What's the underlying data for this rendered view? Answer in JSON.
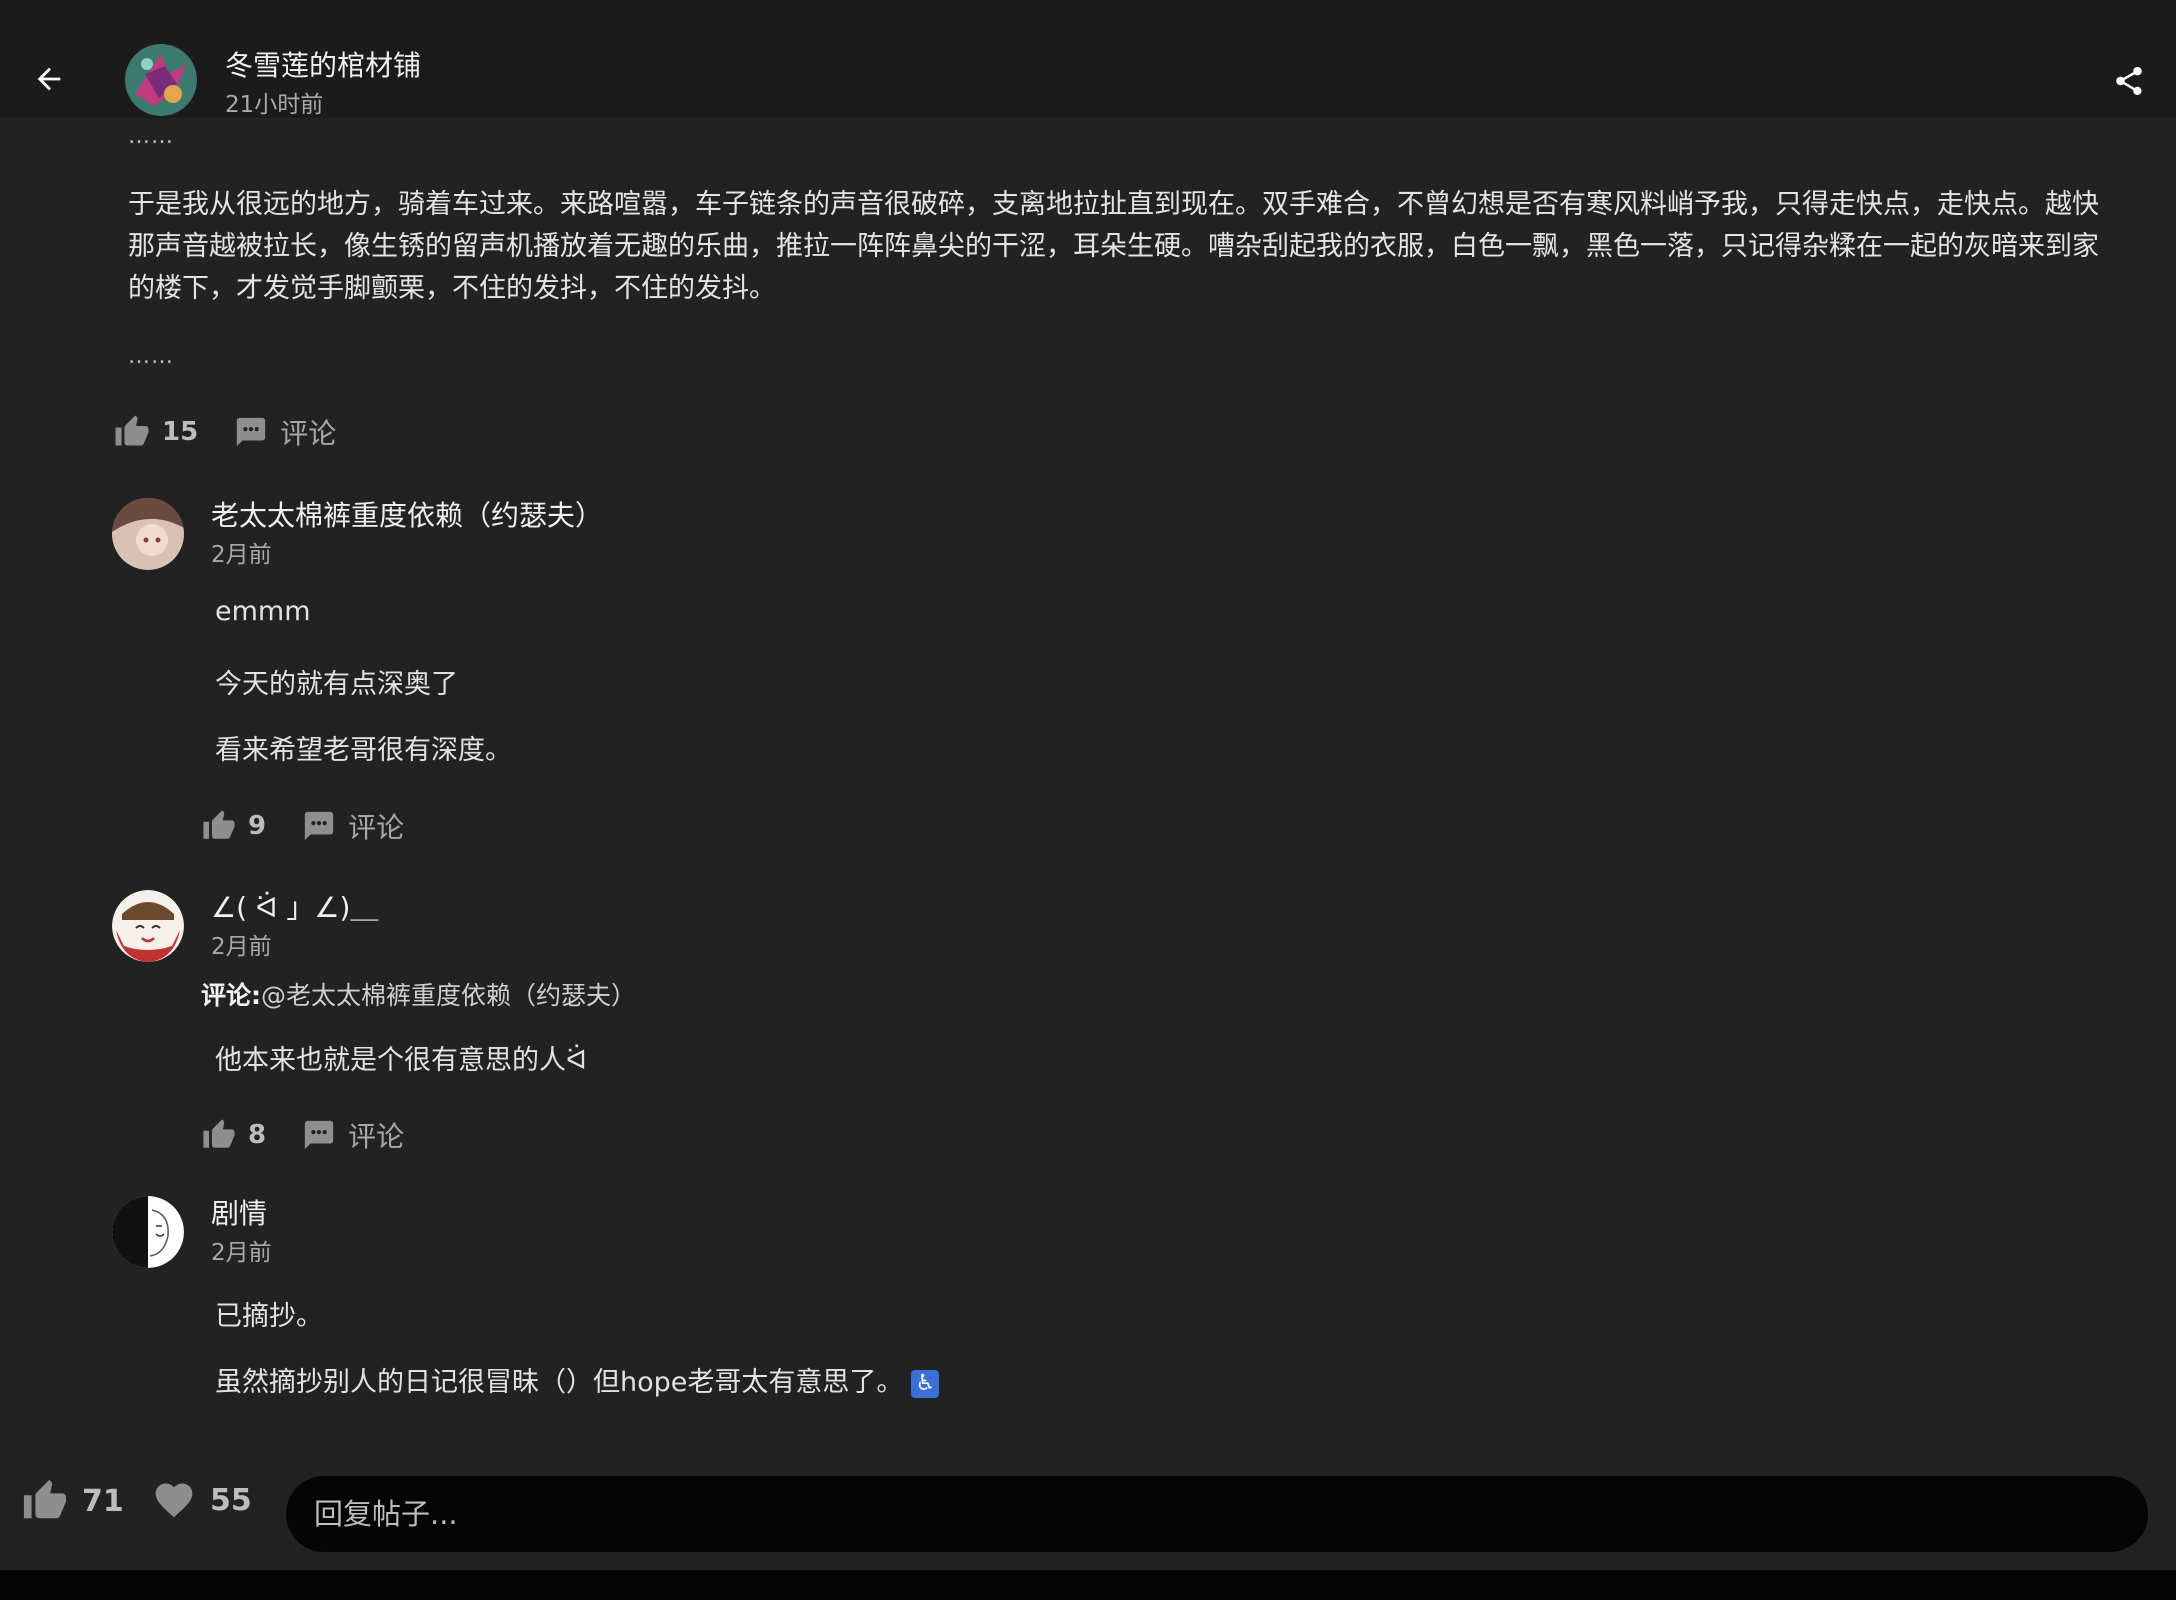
{
  "header": {
    "author_name": "冬雪莲的棺材铺",
    "author_time": "21小时前"
  },
  "post": {
    "ellipsis_top": "……",
    "body": "于是我从很远的地方，骑着车过来。来路喧嚣，车子链条的声音很破碎，支离地拉扯直到现在。双手难合，不曾幻想是否有寒风料峭予我，只得走快点，走快点。越快那声音越被拉长，像生锈的留声机播放着无趣的乐曲，推拉一阵阵鼻尖的干涩，耳朵生硬。嘈杂刮起我的衣服，白色一飘，黑色一落，只记得杂糅在一起的灰暗来到家的楼下，才发觉手脚颤栗，不住的发抖，不住的发抖。",
    "ellipsis_bottom": "……",
    "like_count": "15",
    "comment_label": "评论"
  },
  "comments": [
    {
      "name": "老太太棉裤重度依赖（约瑟夫）",
      "time": "2月前",
      "lines": [
        "emmm",
        "今天的就有点深奥了",
        "看来希望老哥很有深度。"
      ],
      "like_count": "9",
      "comment_label": "评论"
    },
    {
      "name": "∠( ᐛ 」∠)＿",
      "time": "2月前",
      "reply_prefix": "评论:",
      "reply_target": "@老太太棉裤重度依赖（约瑟夫）",
      "lines": [
        "他本来也就是个很有意思的人ᐛ"
      ],
      "like_count": "8",
      "comment_label": "评论"
    },
    {
      "name": "剧情",
      "time": "2月前",
      "lines": [
        "已摘抄。",
        "虽然摘抄别人的日记很冒昧（）但hope老哥太有意思了。"
      ],
      "emoji": "♿"
    }
  ],
  "bottom": {
    "like_count": "71",
    "fav_count": "55",
    "reply_placeholder": "回复帖子..."
  },
  "icons": {
    "back": "arrow-left-icon",
    "share": "share-icon",
    "like": "thumbs-up-icon",
    "comment": "comment-bubble-icon",
    "favorite": "heart-icon"
  },
  "colors": {
    "background": "#222222",
    "header": "#1b1b1b",
    "input": "#050505",
    "icon_gray": "#8e8e8e"
  }
}
